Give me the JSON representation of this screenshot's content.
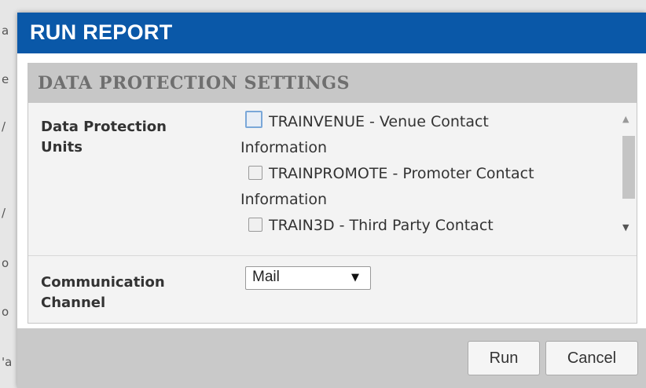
{
  "background_page": {
    "edge_chars": [
      "a",
      "e",
      "/",
      "/",
      "o",
      "o",
      "'a"
    ]
  },
  "dialog": {
    "title": "RUN REPORT",
    "header_color": "#0a58a8",
    "section": {
      "title": "DATA PROTECTION SETTINGS",
      "data_protection_units": {
        "label_line1": "Data Protection",
        "label_line2": "Units",
        "items": [
          {
            "line1": "TRAINVENUE - Venue Contact",
            "line2": "Information",
            "checked": false,
            "focused": true
          },
          {
            "line1": "TRAINPROMOTE - Promoter Contact",
            "line2": "Information",
            "checked": false,
            "focused": false
          },
          {
            "line1": "TRAIN3D - Third Party Contact",
            "line2": "",
            "checked": false,
            "focused": false
          }
        ]
      },
      "communication_channel": {
        "label_line1": "Communication",
        "label_line2": "Channel",
        "selected": "Mail"
      }
    },
    "buttons": {
      "run": "Run",
      "cancel": "Cancel"
    }
  },
  "icons": {
    "dropdown": "triangle-down-icon",
    "scroll_up": "triangle-up-icon",
    "scroll_down": "triangle-down-icon"
  }
}
